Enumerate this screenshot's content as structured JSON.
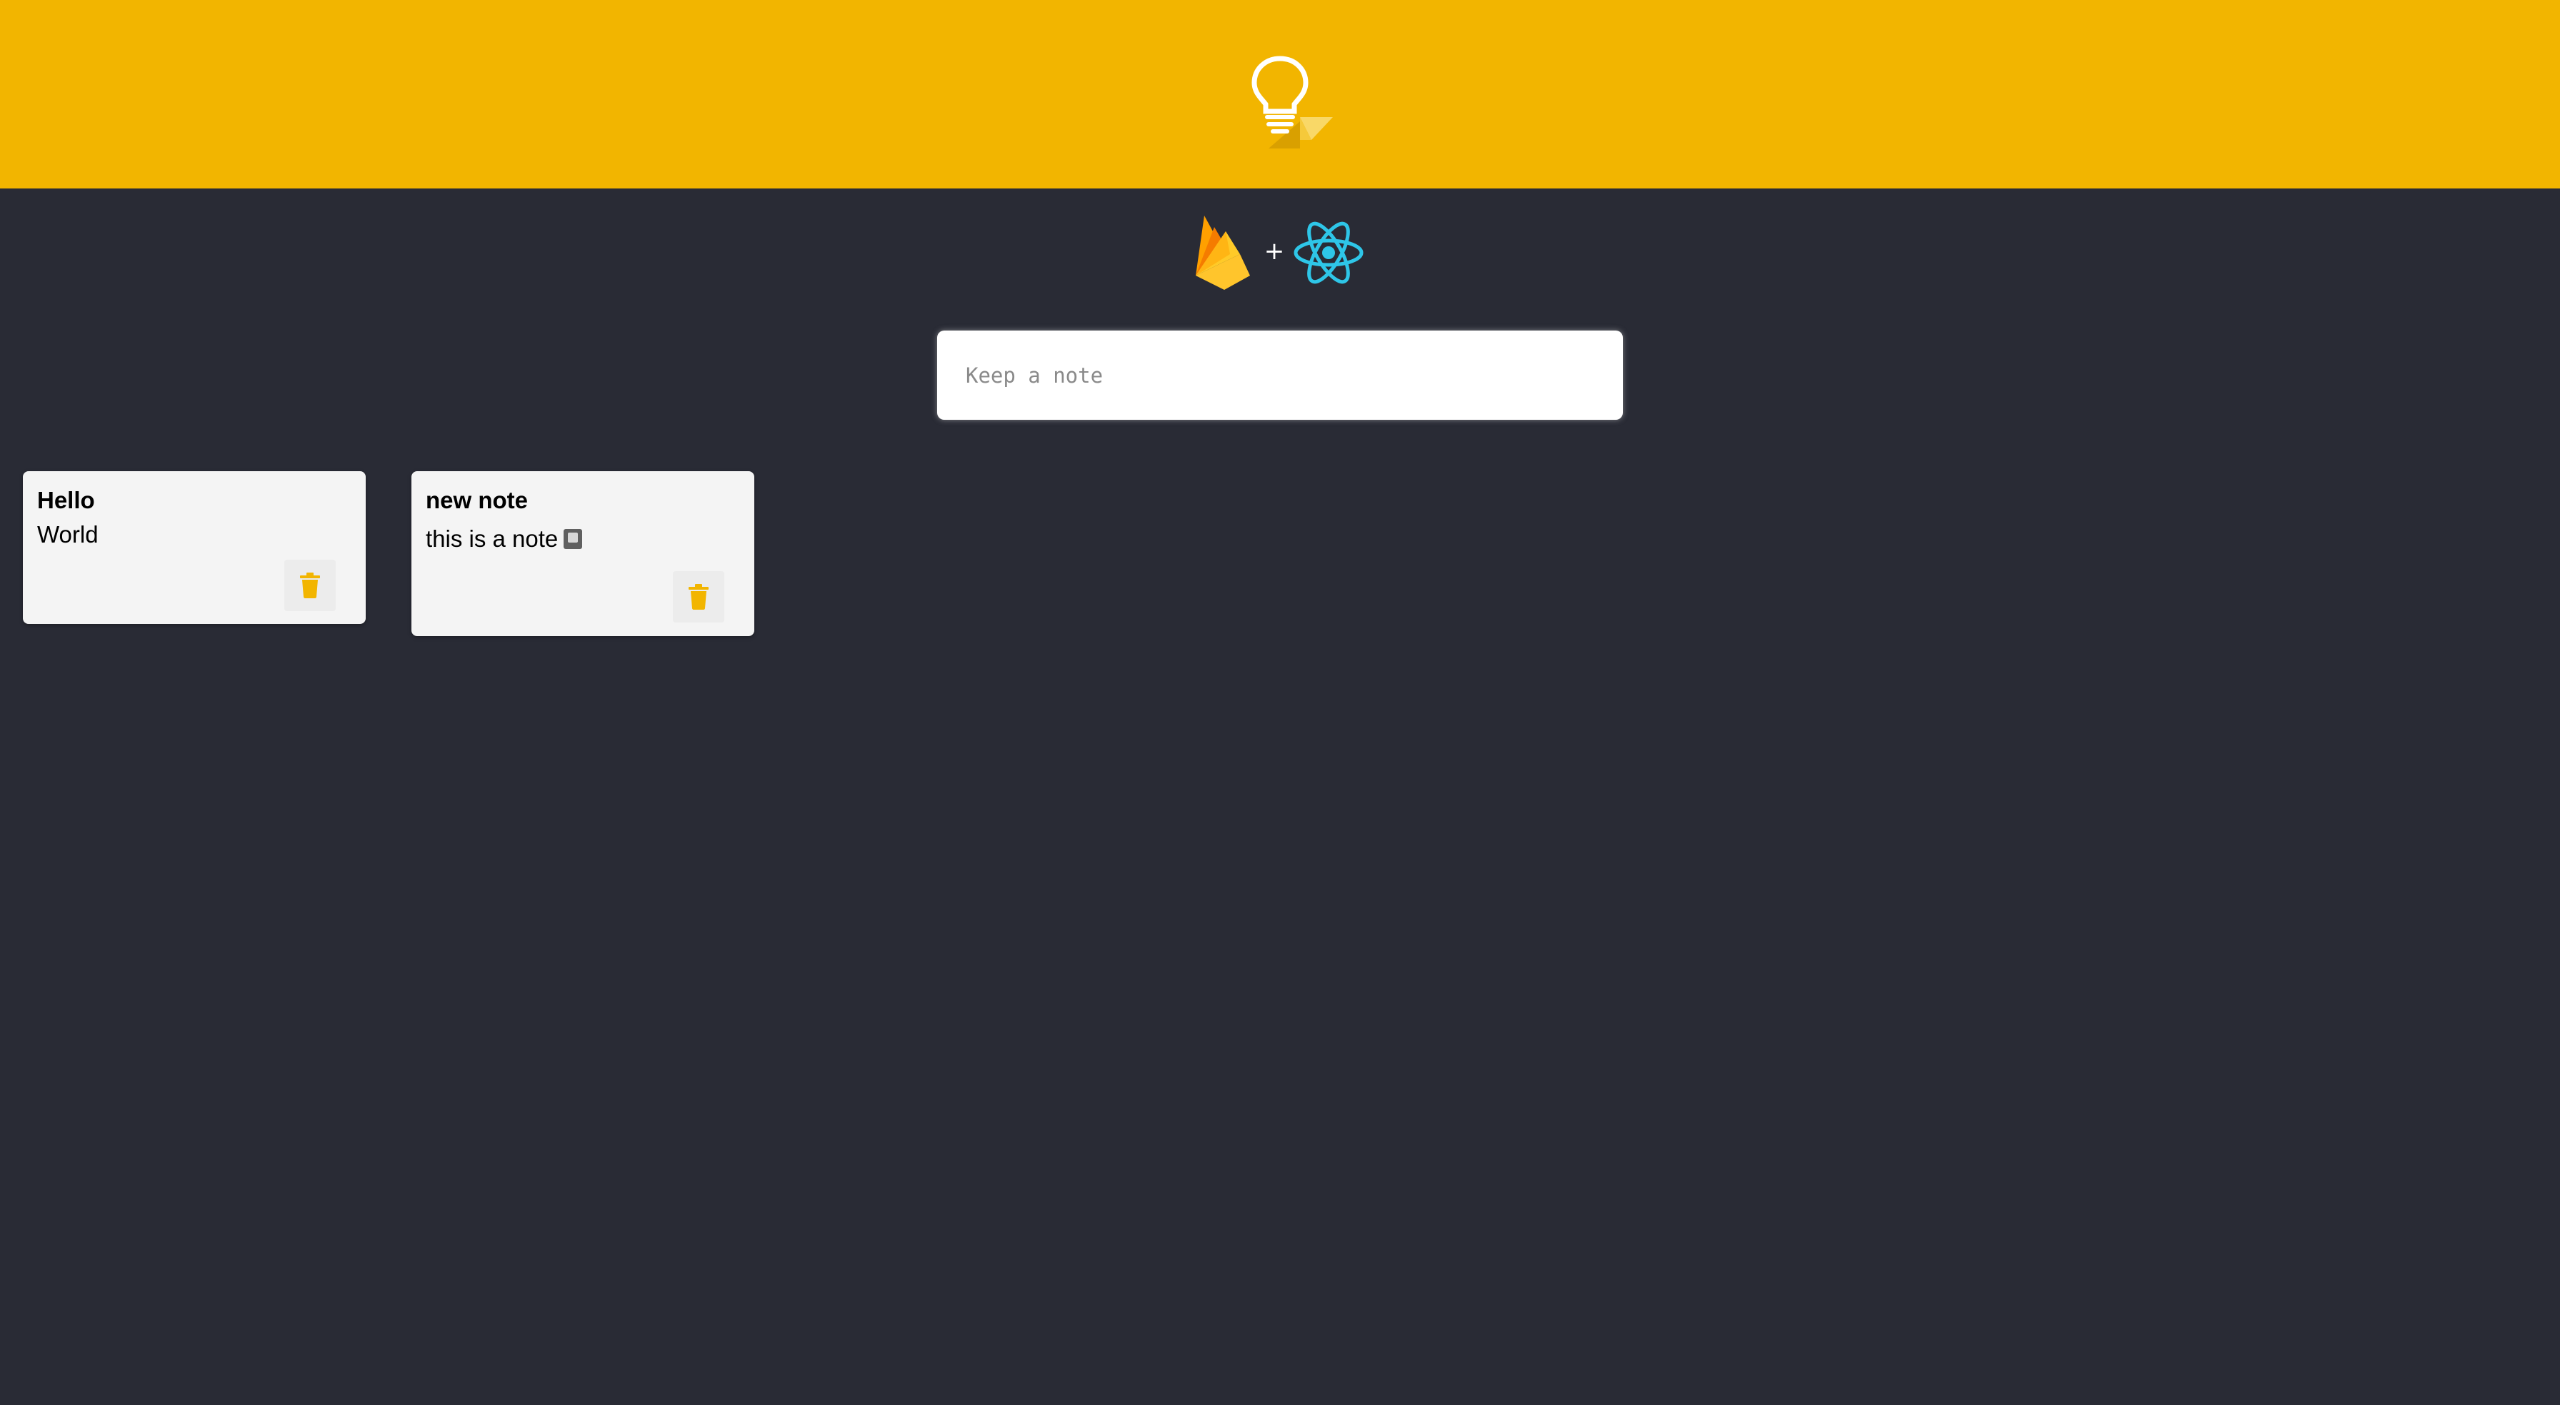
{
  "colors": {
    "header_background": "#f2b500",
    "page_background": "#292b35",
    "card_background": "#f4f4f4",
    "delete_icon": "#f2b500"
  },
  "header": {
    "logo_icon": "keep-lightbulb-icon"
  },
  "tech_stack": {
    "left_icon": "firebase-icon",
    "separator": "+",
    "right_icon": "react-icon"
  },
  "note_input": {
    "placeholder": "Keep a note",
    "value": ""
  },
  "notes": [
    {
      "title": "Hello",
      "content": "World",
      "emoji_icon": "",
      "delete_icon": "trash-icon"
    },
    {
      "title": "new note",
      "content": "this is a note",
      "emoji_icon": "notebook-icon",
      "delete_icon": "trash-icon"
    }
  ]
}
